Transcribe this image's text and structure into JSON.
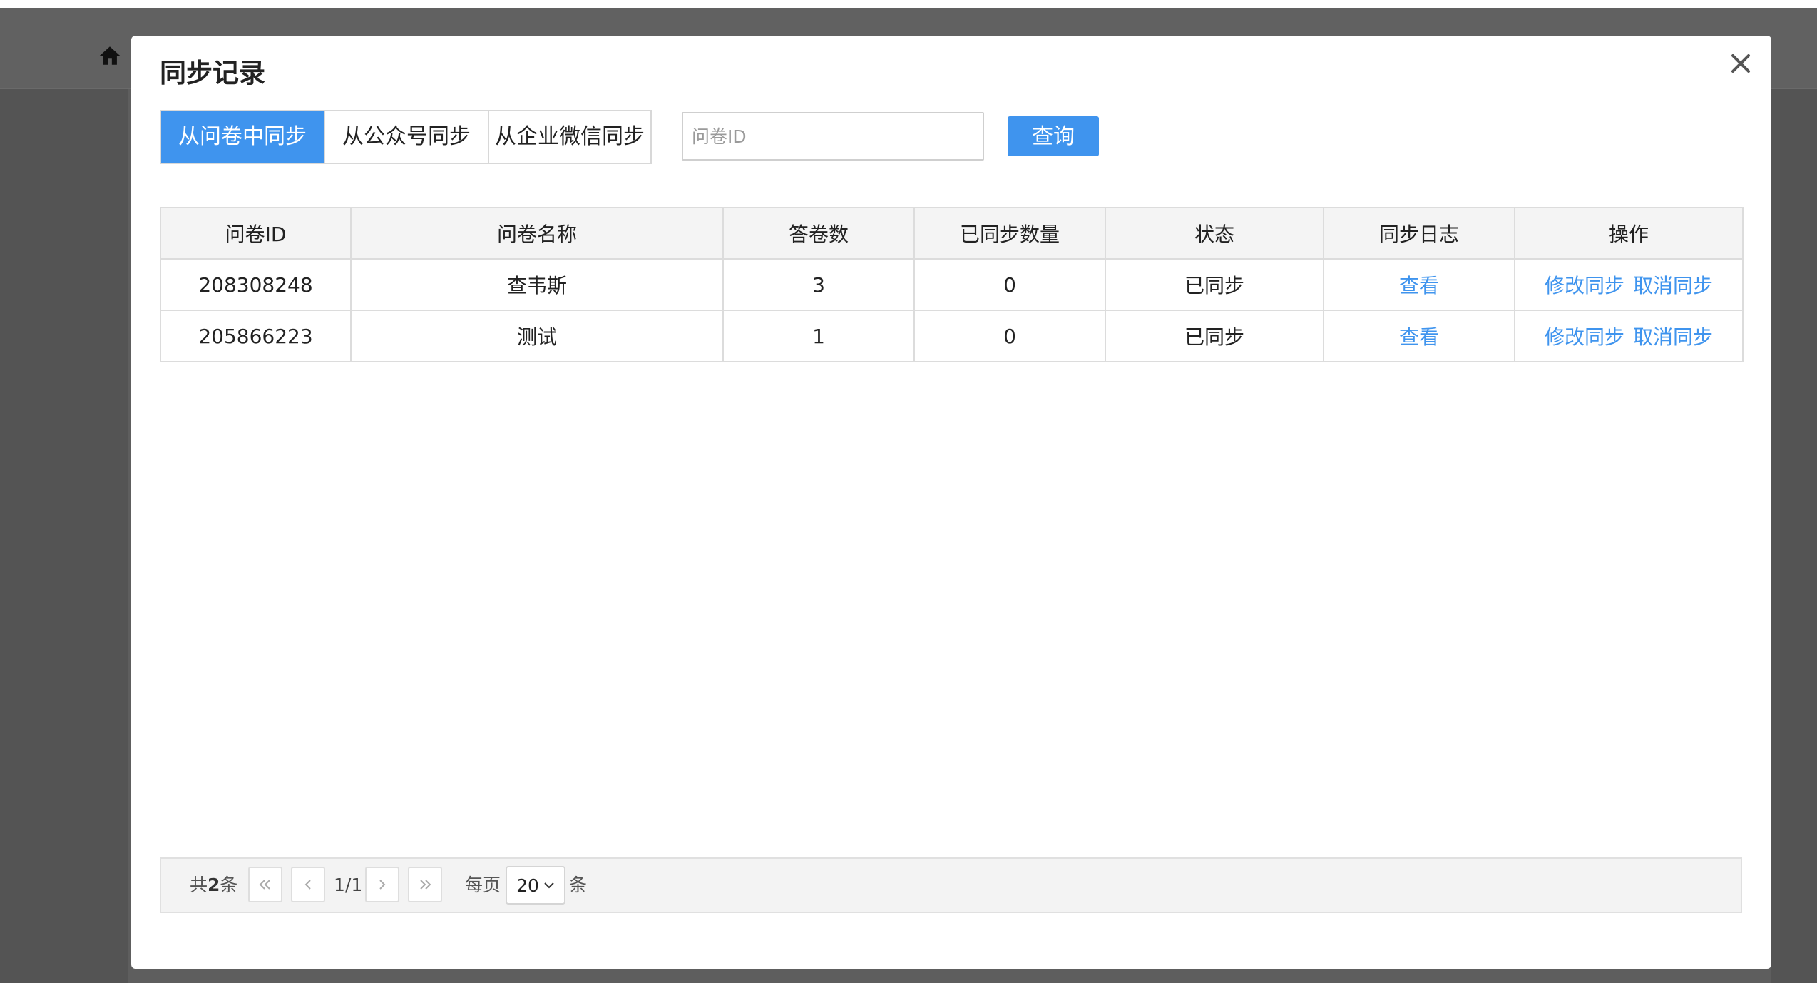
{
  "background": {
    "home_icon": "home-icon"
  },
  "modal": {
    "title": "同步记录",
    "close_icon": "close-icon"
  },
  "tabs": [
    {
      "label": "从问卷中同步",
      "active": true
    },
    {
      "label": "从公众号同步",
      "active": false
    },
    {
      "label": "从企业微信同步",
      "active": false
    }
  ],
  "search": {
    "value": "",
    "placeholder": "问卷ID",
    "button_label": "查询"
  },
  "table": {
    "headers": [
      "问卷ID",
      "问卷名称",
      "答卷数",
      "已同步数量",
      "状态",
      "同步日志",
      "操作"
    ],
    "rows": [
      {
        "id": "208308248",
        "name": "查韦斯",
        "answers": "3",
        "synced": "0",
        "status": "已同步",
        "log_link": "查看",
        "edit_link": "修改同步",
        "cancel_link": "取消同步"
      },
      {
        "id": "205866223",
        "name": "测试",
        "answers": "1",
        "synced": "0",
        "status": "已同步",
        "log_link": "查看",
        "edit_link": "修改同步",
        "cancel_link": "取消同步"
      }
    ]
  },
  "pager": {
    "total_prefix": "共",
    "total_count": "2",
    "total_suffix": "条",
    "page_indicator": "1/1",
    "per_page_label": "每页",
    "per_page_value": "20",
    "per_page_unit": "条"
  },
  "colors": {
    "accent": "#3f94ee",
    "overlay": "#5e5e5e"
  }
}
